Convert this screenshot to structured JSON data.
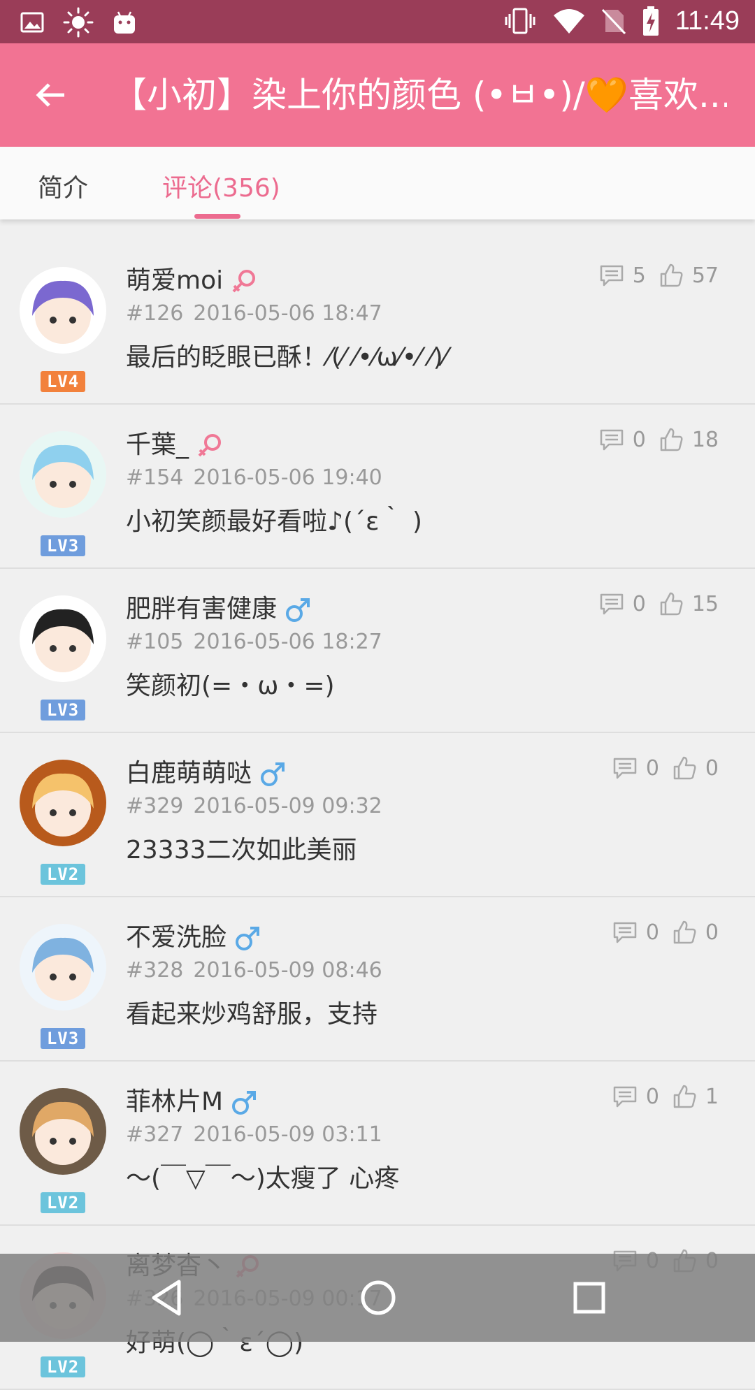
{
  "status_bar": {
    "time": "11:49",
    "left_icons": [
      "image-icon",
      "brightness-icon",
      "android-icon"
    ],
    "right_icons": [
      "vibrate-icon",
      "wifi-icon",
      "no-sim-icon",
      "battery-charging-icon"
    ]
  },
  "app_bar": {
    "title": "【小初】染上你的颜色 (•ㅂ•)/🧡喜欢..."
  },
  "tabs": {
    "intro": "简介",
    "comments": "评论(356)"
  },
  "comments": [
    {
      "name": "萌爱moi",
      "gender": "female",
      "floor": "#126",
      "time": "2016-05-06 18:47",
      "text": "最后的眨眼已酥！⁄(⁄ ⁄•⁄ω⁄•⁄ ⁄)⁄",
      "replies": "5",
      "likes": "57",
      "level": "LV4"
    },
    {
      "name": "千葉_",
      "gender": "female",
      "floor": "#154",
      "time": "2016-05-06 19:40",
      "text": "小初笑颜最好看啦♪(´ε｀ )",
      "replies": "0",
      "likes": "18",
      "level": "LV3"
    },
    {
      "name": "肥胖有害健康",
      "gender": "male",
      "floor": "#105",
      "time": "2016-05-06 18:27",
      "text": "笑颜初(=・ω・=)",
      "replies": "0",
      "likes": "15",
      "level": "LV3"
    },
    {
      "name": "白鹿萌萌哒",
      "gender": "male",
      "floor": "#329",
      "time": "2016-05-09 09:32",
      "text": "23333二次如此美丽",
      "replies": "0",
      "likes": "0",
      "level": "LV2"
    },
    {
      "name": "不爱洗脸",
      "gender": "male",
      "floor": "#328",
      "time": "2016-05-09 08:46",
      "text": "看起来炒鸡舒服，支持",
      "replies": "0",
      "likes": "0",
      "level": "LV3"
    },
    {
      "name": "菲林片M",
      "gender": "male",
      "floor": "#327",
      "time": "2016-05-09 03:11",
      "text": "～(￣▽￣～)太瘦了 心疼",
      "replies": "0",
      "likes": "1",
      "level": "LV2"
    },
    {
      "name": "离梦杳丶",
      "gender": "female",
      "floor": "#326",
      "time": "2016-05-09 00:17",
      "text": "好萌(◯｀ε´◯)",
      "replies": "0",
      "likes": "0",
      "level": "LV2"
    }
  ],
  "colors": {
    "status_bar": "#9a3d58",
    "app_bar": "#f27393",
    "accent": "#ec6b8f",
    "female": "#f07896",
    "male": "#5aa9e6",
    "lv4": "#f2813c",
    "lv3": "#6f9ddd",
    "lv2": "#6cc4dc"
  },
  "nav_bar": {
    "icons": [
      "back-icon",
      "home-icon",
      "recents-icon"
    ]
  }
}
